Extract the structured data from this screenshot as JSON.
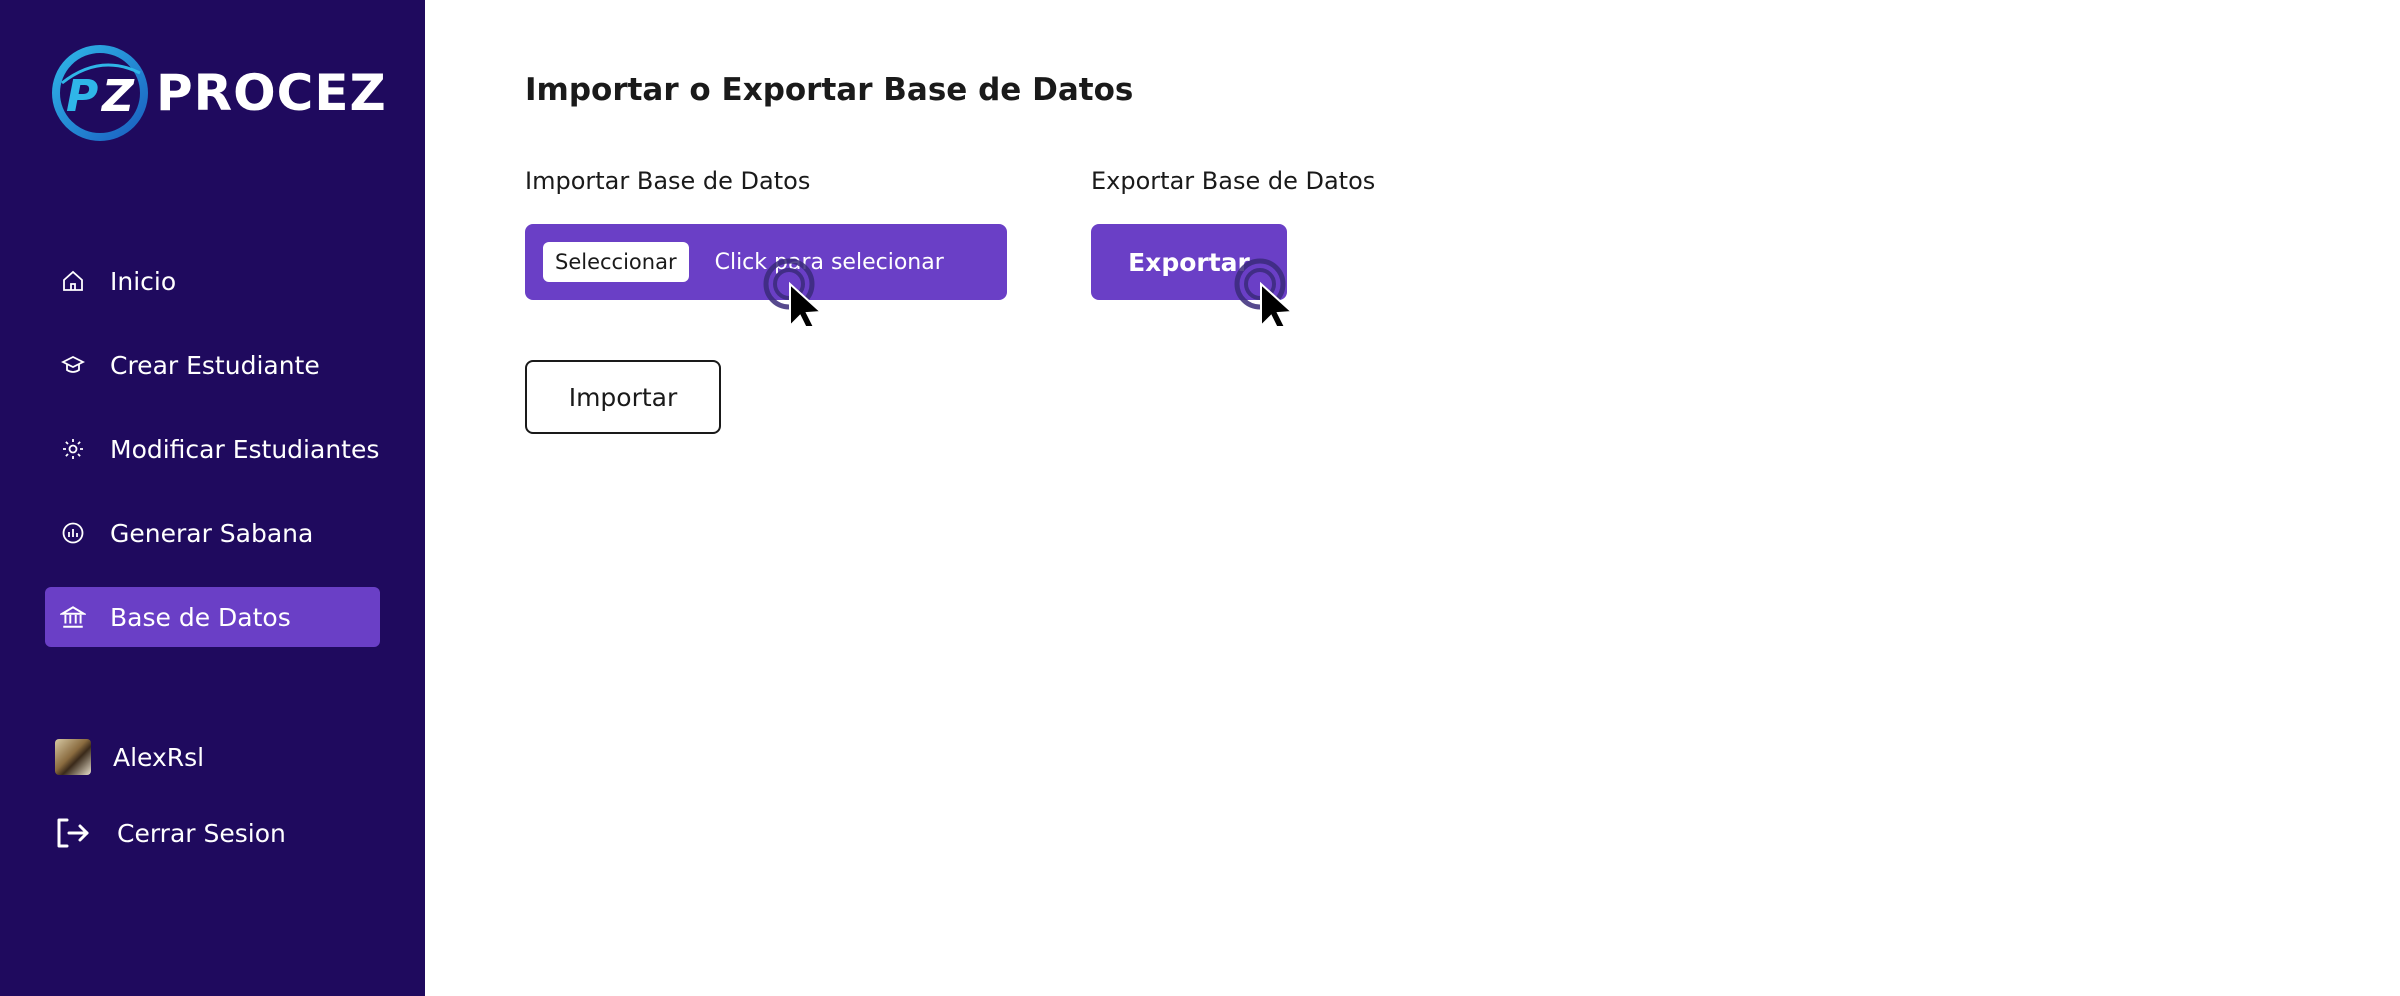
{
  "brand": {
    "name": "PROCEZ",
    "mark": "PZ"
  },
  "sidebar": {
    "items": [
      {
        "label": "Inicio",
        "icon": "home-icon",
        "active": false
      },
      {
        "label": "Crear Estudiante",
        "icon": "graduation-cap-icon",
        "active": false
      },
      {
        "label": "Modificar Estudiantes",
        "icon": "gear-icon",
        "active": false
      },
      {
        "label": "Generar Sabana",
        "icon": "chart-icon",
        "active": false
      },
      {
        "label": "Base de Datos",
        "icon": "bank-icon",
        "active": true
      }
    ],
    "user": {
      "name": "AlexRsl",
      "icon": "avatar"
    },
    "logout": {
      "label": "Cerrar Sesion",
      "icon": "logout-icon"
    }
  },
  "main": {
    "title": "Importar o Exportar Base de Datos",
    "import": {
      "label": "Importar Base de Datos",
      "file_button": "Seleccionar",
      "file_placeholder": "Click para selecionar",
      "submit": "Importar"
    },
    "export": {
      "label": "Exportar Base de Datos",
      "button": "Exportar"
    }
  },
  "colors": {
    "sidebar_bg": "#1f0a5e",
    "accent": "#6a3fc6",
    "text": "#1a1a1a"
  }
}
